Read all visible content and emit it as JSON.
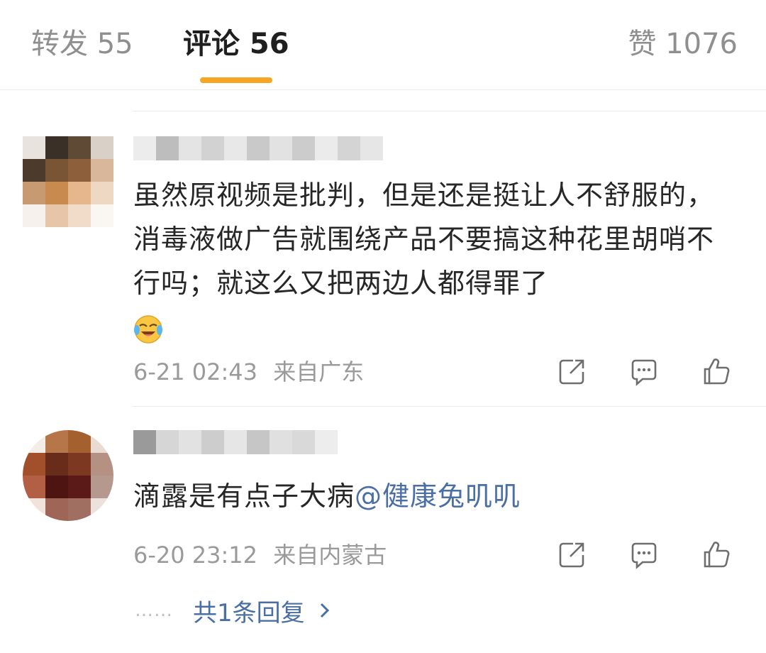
{
  "tabs": {
    "repost": "转发 55",
    "comments": "评论 56",
    "likes": "赞 1076"
  },
  "colors": {
    "accent": "#f5a623",
    "mention": "#4a6fa5",
    "meta": "#9a9a9a"
  },
  "comments": [
    {
      "text": "虽然原视频是批判，但是还是挺让人不舒服的，消毒液做广告就围绕产品不要搞这种花里胡哨不行吗；就这么又把两边人都得罪了",
      "emoji": "laughing-crying-emoji",
      "time": "6-21 02:43",
      "location": "来自广东"
    },
    {
      "text": "滴露是有点子大病",
      "mention": "@健康兔叽叽",
      "time": "6-20 23:12",
      "location": "来自内蒙古",
      "reply_link": "共1条回复",
      "reply_dots": "……"
    }
  ],
  "icons": {
    "share": "share-icon",
    "comment": "comment-icon",
    "like": "thumbs-up-icon"
  }
}
